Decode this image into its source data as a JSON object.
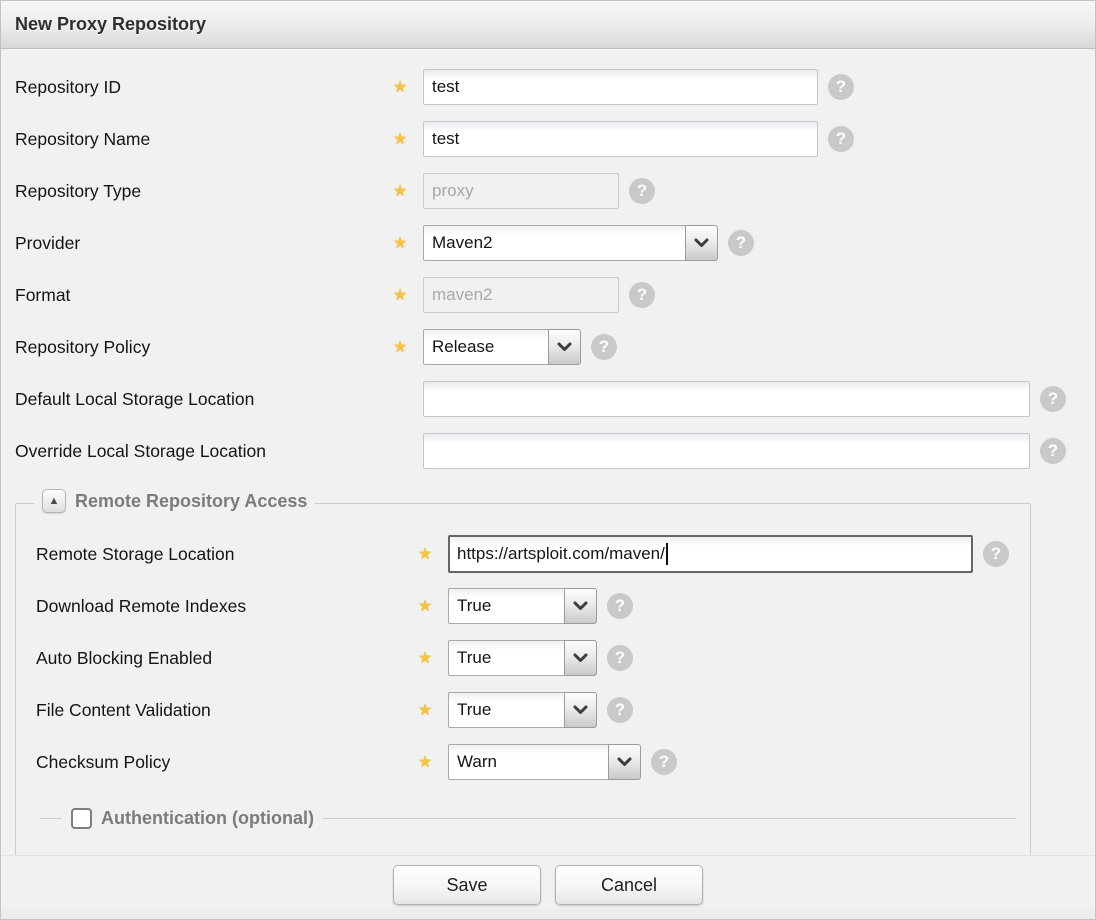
{
  "header": {
    "title": "New Proxy Repository"
  },
  "icons": {
    "required_star": "★",
    "help": "?",
    "collapse": "▲"
  },
  "form": {
    "rows": [
      {
        "label": "Repository ID",
        "value": "test"
      },
      {
        "label": "Repository Name",
        "value": "test"
      },
      {
        "label": "Repository Type",
        "value": "proxy"
      },
      {
        "label": "Provider",
        "value": "Maven2"
      },
      {
        "label": "Format",
        "value": "maven2"
      },
      {
        "label": "Repository Policy",
        "value": "Release"
      },
      {
        "label": "Default Local Storage Location",
        "value": ""
      },
      {
        "label": "Override Local Storage Location",
        "value": ""
      }
    ]
  },
  "remote_section": {
    "legend": "Remote Repository Access",
    "rows": [
      {
        "label": "Remote Storage Location",
        "value": "https://artsploit.com/maven/"
      },
      {
        "label": "Download Remote Indexes",
        "value": "True"
      },
      {
        "label": "Auto Blocking Enabled",
        "value": "True"
      },
      {
        "label": "File Content Validation",
        "value": "True"
      },
      {
        "label": "Checksum Policy",
        "value": "Warn"
      }
    ],
    "auth_legend": "Authentication (optional)"
  },
  "buttons": {
    "save": "Save",
    "cancel": "Cancel"
  },
  "colors": {
    "star": "#F6C342",
    "legend_text": "#7B7B7B",
    "help_bg": "#C9C9C9",
    "panel_bg": "#F1F1F1"
  }
}
